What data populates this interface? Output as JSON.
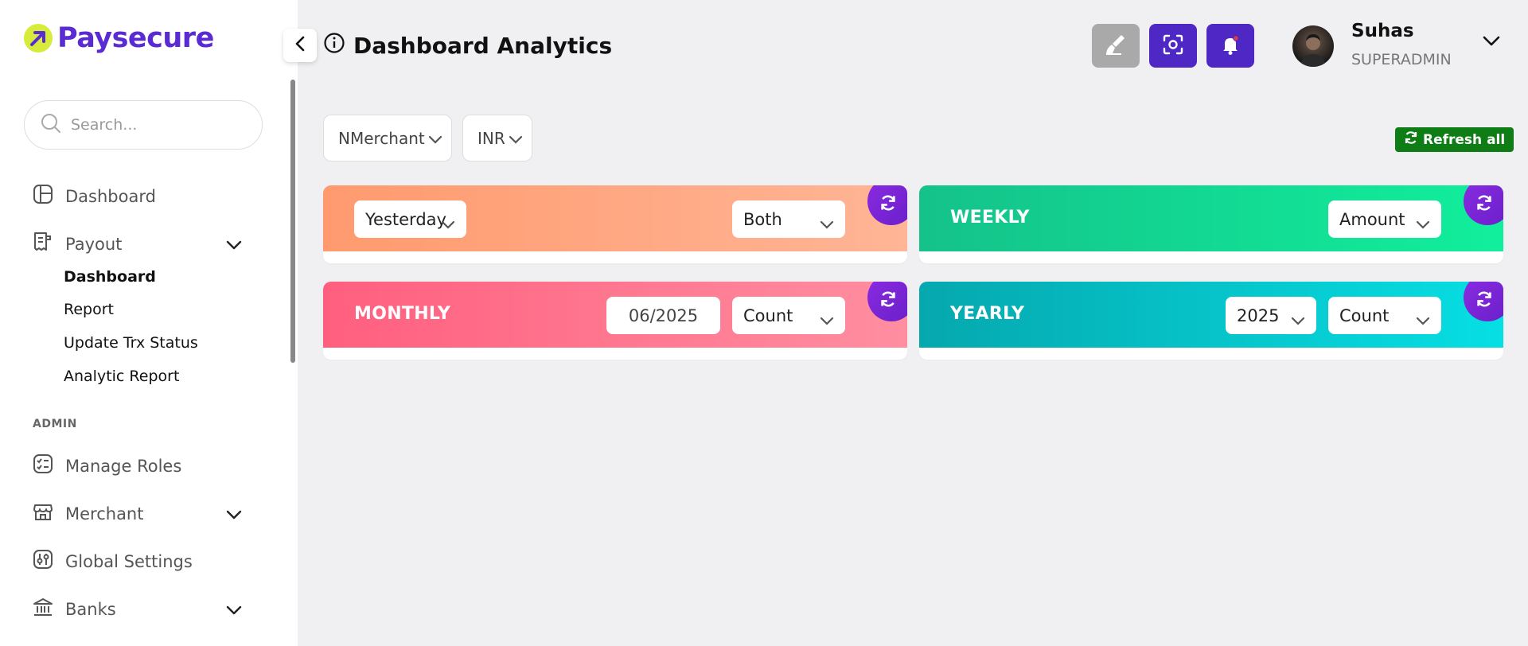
{
  "brand": {
    "name": "Paysecure",
    "accent": "#5a2bd3",
    "logo_mark_color": "#d7ec3a"
  },
  "sidebar": {
    "search_placeholder": "Search...",
    "items": [
      {
        "label": "Dashboard",
        "icon": "dashboard-icon"
      },
      {
        "label": "Payout",
        "icon": "receipt-icon",
        "expanded": true,
        "children": [
          {
            "label": "Dashboard",
            "active": true
          },
          {
            "label": "Report"
          },
          {
            "label": "Update Trx Status"
          },
          {
            "label": "Analytic Report"
          }
        ]
      }
    ],
    "section_admin": "ADMIN",
    "admin_items": [
      {
        "label": "Manage Roles",
        "icon": "checklist-icon"
      },
      {
        "label": "Merchant",
        "icon": "store-icon"
      },
      {
        "label": "Global Settings",
        "icon": "settings-sliders-icon"
      },
      {
        "label": "Banks",
        "icon": "bank-icon"
      }
    ]
  },
  "header": {
    "title": "Dashboard Analytics",
    "buttons": [
      {
        "icon": "broom-icon",
        "color": "#a9a9a9"
      },
      {
        "icon": "screenshot-icon",
        "color": "#4e27c4"
      },
      {
        "icon": "bell-icon",
        "color": "#4e27c4"
      }
    ],
    "user": {
      "name": "Suhas",
      "role": "SUPERADMIN"
    }
  },
  "filters": {
    "merchant": "NMerchant",
    "currency": "INR",
    "refresh_all": "Refresh all",
    "refresh_color": "#0f7d16"
  },
  "cards": {
    "daily": {
      "period": "Yesterday",
      "metric": "Both"
    },
    "weekly": {
      "label": "WEEKLY",
      "metric": "Amount"
    },
    "monthly": {
      "label": "MONTHLY",
      "month": "06/2025",
      "metric": "Count"
    },
    "yearly": {
      "label": "YEARLY",
      "year": "2025",
      "metric": "Count"
    }
  }
}
